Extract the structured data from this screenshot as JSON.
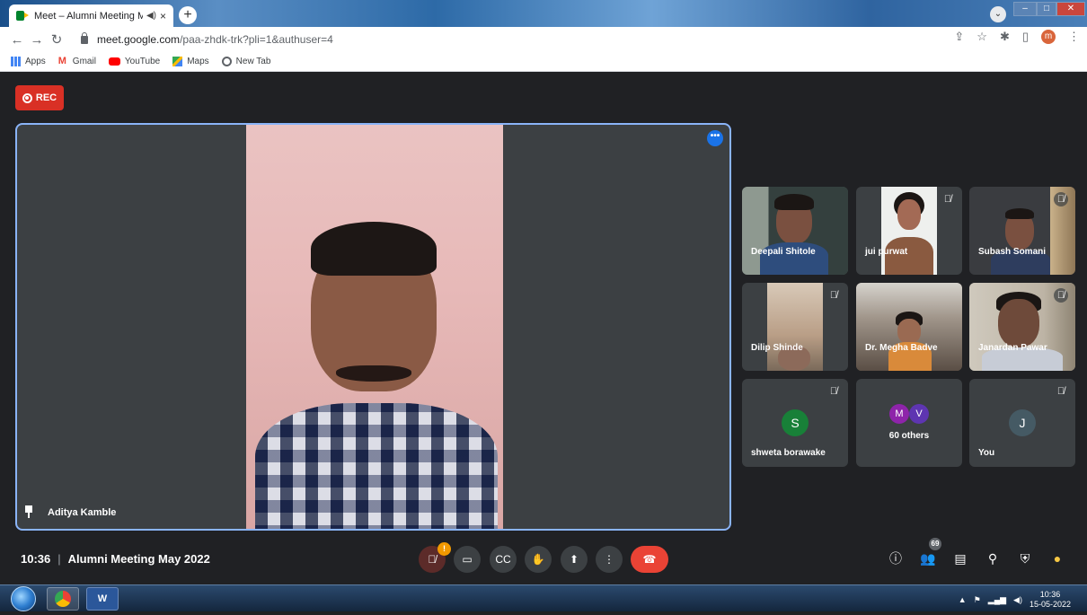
{
  "browser": {
    "tab_title": "Meet – Alumni Meeting May",
    "tab_close": "×",
    "new_tab": "+",
    "url_host": "meet.google.com",
    "url_path": "/paa-zhdk-trk?pli=1&authuser=4",
    "profile_initial": "m",
    "bookmarks": [
      "Apps",
      "Gmail",
      "YouTube",
      "Maps",
      "New Tab"
    ]
  },
  "rec_label": "REC",
  "main_speaker": {
    "name": "Aditya Kamble"
  },
  "participants": [
    {
      "name": "Deepali Shitole"
    },
    {
      "name": "jui purwat"
    },
    {
      "name": "Subash Somani"
    },
    {
      "name": "Dilip Shinde"
    },
    {
      "name": "Dr. Megha Badve"
    },
    {
      "name": "Janardan Pawar"
    },
    {
      "name": "shweta borawake",
      "initial": "S"
    },
    {
      "name": "60 others",
      "initials": [
        "M",
        "V"
      ]
    },
    {
      "name": "You",
      "initial": "J"
    }
  ],
  "meeting": {
    "time": "10:36",
    "separator": "|",
    "title": "Alumni Meeting May 2022"
  },
  "people_count": "69",
  "colors": {
    "accent": "#1a73e8",
    "rec": "#d93025",
    "end_call": "#ea4335",
    "bg": "#202124"
  },
  "taskbar": {
    "time": "10:36",
    "date": "15-05-2022",
    "word_label": "W"
  }
}
